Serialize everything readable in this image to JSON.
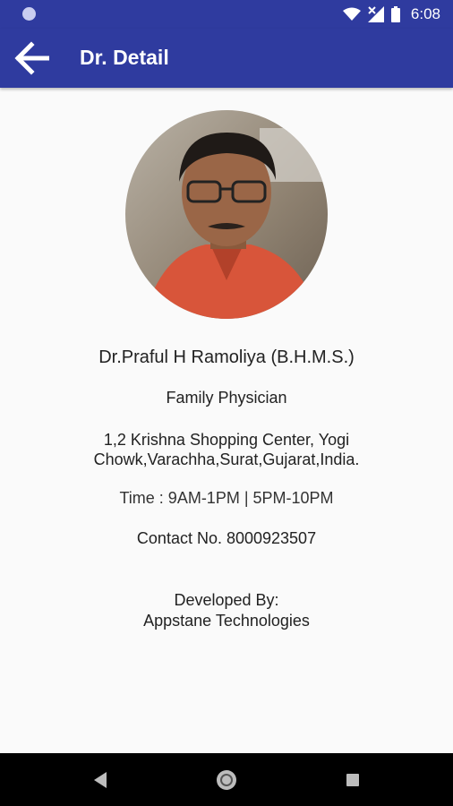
{
  "status_bar": {
    "time": "6:08",
    "icons": [
      "notification-dot-icon",
      "wifi-icon",
      "cellular-signal-icon",
      "battery-icon"
    ]
  },
  "toolbar": {
    "title": "Dr. Detail",
    "back_icon": "arrow-back-icon"
  },
  "doctor": {
    "name": "Dr.Praful H Ramoliya (B.H.M.S.)",
    "specialty": "Family Physician",
    "address_line1": "1,2 Krishna Shopping Center, Yogi",
    "address_line2": "Chowk,Varachha,Surat,Gujarat,India.",
    "time": "Time : 9AM-1PM | 5PM-10PM",
    "contact": "Contact No. 8000923507"
  },
  "developer": {
    "label": "Developed By:",
    "company": "Appstane Technologies"
  },
  "nav_bar": {
    "icons": [
      "nav-back-icon",
      "nav-home-icon",
      "nav-recents-icon"
    ]
  },
  "colors": {
    "primary": "#2f3b9f",
    "background": "#fafafa",
    "text": "#222222"
  }
}
